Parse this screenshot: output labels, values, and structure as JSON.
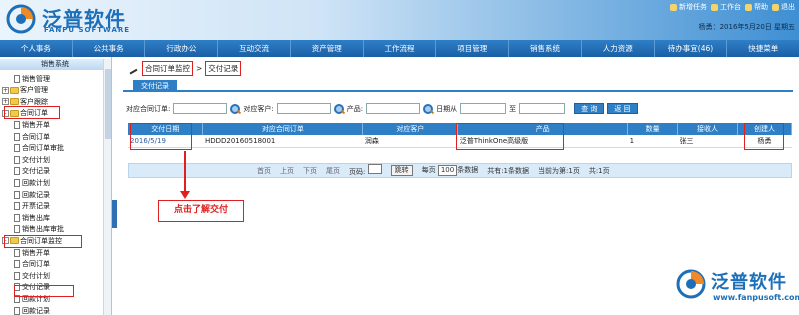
{
  "header": {
    "logo_text": "泛普软件",
    "logo_sub": "FANPU SOFTWARE",
    "links": [
      "新增任务",
      "工作台",
      "帮助",
      "退出"
    ],
    "user_info": "杨勇：2016年5月20日 星期五"
  },
  "navbar": [
    "个人事务",
    "公共事务",
    "行政办公",
    "互动交流",
    "资产管理",
    "工作流程",
    "项目管理",
    "销售系统",
    "人力资源",
    "待办事宜(46)",
    "快捷菜单"
  ],
  "sidebar": {
    "title": "销售系统",
    "items": [
      {
        "label": "销售管理",
        "level": 1,
        "toggle": "",
        "icon": "doc"
      },
      {
        "label": "客户管理",
        "level": 0,
        "toggle": "+",
        "icon": "folder"
      },
      {
        "label": "客户跟踪",
        "level": 0,
        "toggle": "+",
        "icon": "folder"
      },
      {
        "label": "合同订单",
        "level": 0,
        "toggle": "-",
        "icon": "folder"
      },
      {
        "label": "销售开单",
        "level": 1,
        "toggle": "",
        "icon": "doc"
      },
      {
        "label": "合同订单",
        "level": 1,
        "toggle": "",
        "icon": "doc"
      },
      {
        "label": "合同订单审批",
        "level": 1,
        "toggle": "",
        "icon": "doc"
      },
      {
        "label": "交付计划",
        "level": 1,
        "toggle": "",
        "icon": "doc"
      },
      {
        "label": "交付记录",
        "level": 1,
        "toggle": "",
        "icon": "doc"
      },
      {
        "label": "回款计划",
        "level": 1,
        "toggle": "",
        "icon": "doc"
      },
      {
        "label": "回款记录",
        "level": 1,
        "toggle": "",
        "icon": "doc"
      },
      {
        "label": "开票记录",
        "level": 1,
        "toggle": "",
        "icon": "doc"
      },
      {
        "label": "销售出库",
        "level": 1,
        "toggle": "",
        "icon": "doc"
      },
      {
        "label": "销售出库审批",
        "level": 1,
        "toggle": "",
        "icon": "doc"
      },
      {
        "label": "合同订单监控",
        "level": 0,
        "toggle": "-",
        "icon": "folder"
      },
      {
        "label": "销售开单",
        "level": 1,
        "toggle": "",
        "icon": "doc"
      },
      {
        "label": "合同订单",
        "level": 1,
        "toggle": "",
        "icon": "doc"
      },
      {
        "label": "交付计划",
        "level": 1,
        "toggle": "",
        "icon": "doc"
      },
      {
        "label": "交付记录",
        "level": 1,
        "toggle": "",
        "icon": "doc"
      },
      {
        "label": "回款计划",
        "level": 1,
        "toggle": "",
        "icon": "doc"
      },
      {
        "label": "回款记录",
        "level": 1,
        "toggle": "",
        "icon": "doc"
      }
    ]
  },
  "breadcrumb": {
    "parent": "合同订单监控",
    "separator": ">",
    "current": "交付记录"
  },
  "tab_label": "交付记录",
  "filter": {
    "order_label": "对应合同订单:",
    "customer_label": "对应客户:",
    "product_label": "产品:",
    "date_from_label": "日期从",
    "date_to_label": "至",
    "search_btn": "查 询",
    "back_btn": "返 回"
  },
  "table": {
    "headers": [
      "交付日期",
      "对应合同订单",
      "对应客户",
      "产品",
      "数量",
      "接收人",
      "创建人"
    ],
    "rows": [
      [
        "2016/5/19",
        "HDDD20160518001",
        "润森",
        "泛普ThinkOne高级版",
        "1",
        "张三",
        "杨勇"
      ]
    ]
  },
  "pager": {
    "first": "首页",
    "prev": "上页",
    "next": "下页",
    "last": "尾页",
    "page_label": "页码:",
    "go": "跳转",
    "per_page_prefix": "每页",
    "per_page_value": "100",
    "per_page_suffix": "条数据",
    "total": "共有:1条数据",
    "current": "当前为第:1页",
    "pages": "共:1页"
  },
  "annotation": "点击了解交付",
  "watermark": {
    "text": "泛普软件",
    "url": "www.fanpusoft.com"
  },
  "colors": {
    "accent": "#2f7fc6",
    "highlight": "#e02020",
    "brand": "#1d6fb8"
  }
}
